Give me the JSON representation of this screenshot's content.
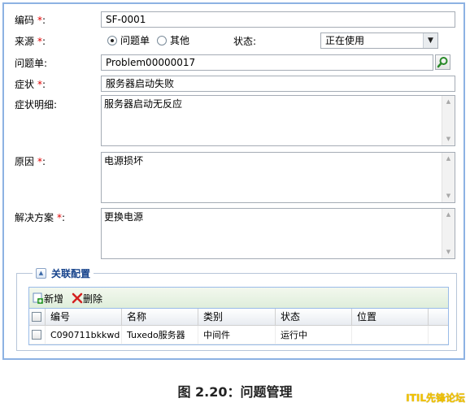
{
  "form": {
    "code": {
      "label": "编码",
      "required_mark": "*",
      "value": "SF-0001"
    },
    "source": {
      "label": "来源",
      "required_mark": "*",
      "options": [
        {
          "label": "问题单",
          "selected": true
        },
        {
          "label": "其他",
          "selected": false
        }
      ]
    },
    "status": {
      "label": "状态:",
      "value": "正在使用"
    },
    "problem": {
      "label": "问题单:",
      "value": "Problem00000017"
    },
    "symptom": {
      "label": "症状",
      "required_mark": "*",
      "value": "服务器启动失败"
    },
    "symptom_detail": {
      "label": "症状明细:",
      "value": "服务器启动无反应"
    },
    "cause": {
      "label": "原因",
      "required_mark": "*",
      "value": "电源损坏"
    },
    "solution": {
      "label": "解决方案",
      "required_mark": "*",
      "value": "更换电源"
    }
  },
  "related": {
    "title": "关联配置",
    "toolbar": {
      "add_label": "新增",
      "delete_label": "删除"
    },
    "columns": [
      "编号",
      "名称",
      "类别",
      "状态",
      "位置"
    ],
    "rows": [
      {
        "id": "C090711bkkwd",
        "name": "Tuxedo服务器",
        "category": "中间件",
        "status": "运行中",
        "location": ""
      }
    ]
  },
  "caption": "图 2.20：问题管理",
  "watermark": "ITIL先锋论坛",
  "icons": {
    "search": "magnifier-icon",
    "add": "add-icon",
    "delete": "delete-x-icon",
    "collapse": "collapse-up-icon",
    "dropdown": "chevron-down-icon"
  },
  "colors": {
    "required": "#e00000",
    "panel_border": "#8db2e3",
    "legend_title": "#15428b",
    "toolbar_bg": "#dfeedb",
    "watermark": "#f2c200"
  }
}
